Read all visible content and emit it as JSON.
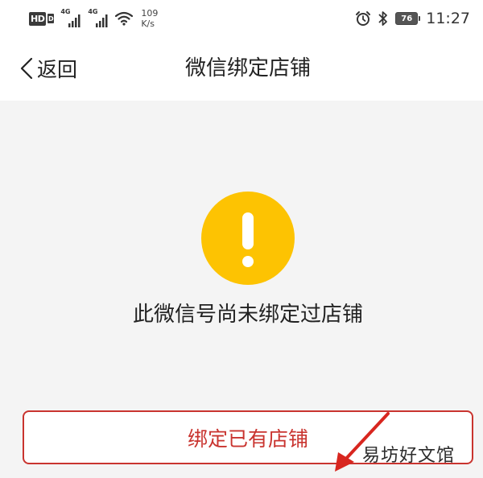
{
  "status_bar": {
    "hd": "HD",
    "hd_sub": "D",
    "network_1": "4G",
    "network_2": "4G",
    "speed_value": "109",
    "speed_unit": "K/s",
    "battery": "76",
    "time": "11:27",
    "icons": [
      "signal-icon",
      "wifi-icon",
      "alarm-icon",
      "bluetooth-icon",
      "battery-icon"
    ]
  },
  "nav": {
    "back_label": "返回",
    "title": "微信绑定店铺"
  },
  "main": {
    "status_icon": "warning-icon",
    "message": "此微信号尚未绑定过店铺",
    "bind_button_label": "绑定已有店铺"
  },
  "watermark": "易坊好文馆",
  "colors": {
    "accent_red": "#c9342f",
    "warning_yellow": "#fdc302",
    "background": "#f4f4f4"
  }
}
